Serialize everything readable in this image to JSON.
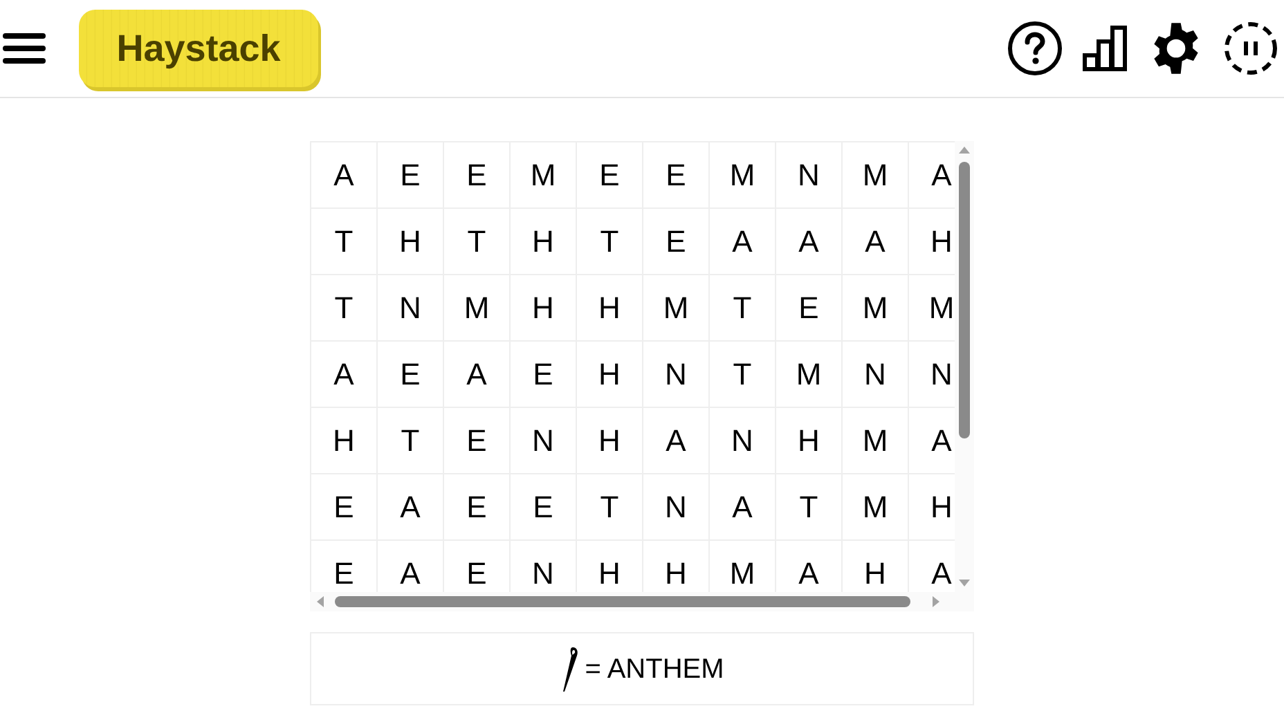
{
  "header": {
    "logo": "Haystack"
  },
  "grid": {
    "rows": [
      [
        "A",
        "E",
        "E",
        "M",
        "E",
        "E",
        "M",
        "N",
        "M",
        "A"
      ],
      [
        "T",
        "H",
        "T",
        "H",
        "T",
        "E",
        "A",
        "A",
        "A",
        "H"
      ],
      [
        "T",
        "N",
        "M",
        "H",
        "H",
        "M",
        "T",
        "E",
        "M",
        "M"
      ],
      [
        "A",
        "E",
        "A",
        "E",
        "H",
        "N",
        "T",
        "M",
        "N",
        "N"
      ],
      [
        "H",
        "T",
        "E",
        "N",
        "H",
        "A",
        "N",
        "H",
        "M",
        "A"
      ],
      [
        "E",
        "A",
        "E",
        "E",
        "T",
        "N",
        "A",
        "T",
        "M",
        "H"
      ],
      [
        "E",
        "A",
        "E",
        "N",
        "H",
        "H",
        "M",
        "A",
        "H",
        "A"
      ]
    ]
  },
  "clue": {
    "text": "= ANTHEM"
  }
}
